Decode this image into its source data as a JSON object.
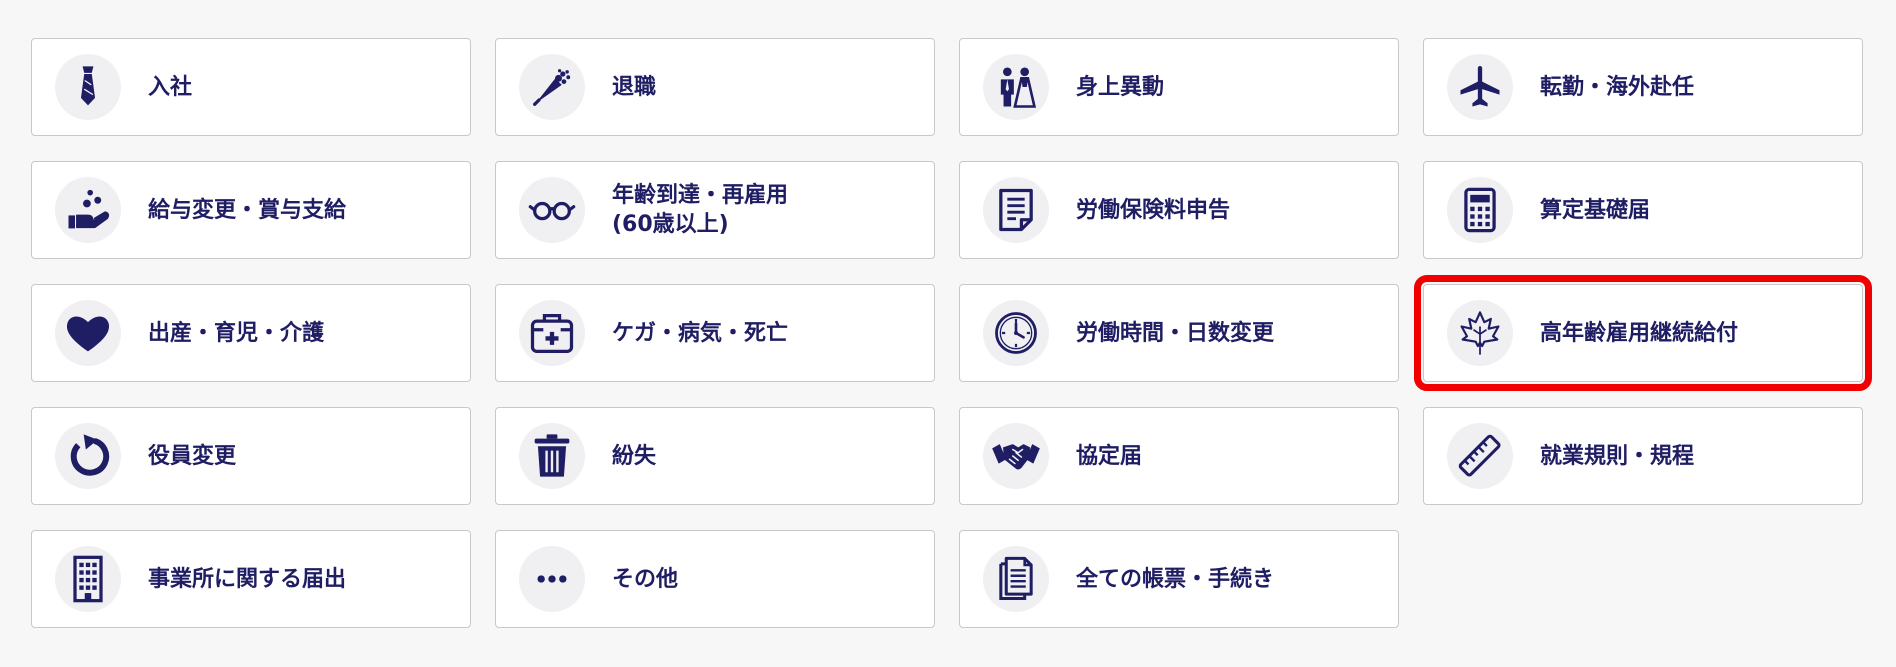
{
  "colors": {
    "accent": "#1f1d63",
    "highlight": "#f00000",
    "background": "#f7f7f7"
  },
  "cards": [
    {
      "label": "入社",
      "icon": "necktie-icon"
    },
    {
      "label": "退職",
      "icon": "bouquet-icon"
    },
    {
      "label": "身上異動",
      "icon": "wedding-couple-icon"
    },
    {
      "label": "転勤・海外赴任",
      "icon": "airplane-icon"
    },
    {
      "label": "給与変更・賞与支給",
      "icon": "hand-coins-icon"
    },
    {
      "label": "年齢到達・再雇用\n(60歳以上)",
      "icon": "glasses-icon"
    },
    {
      "label": "労働保険料申告",
      "icon": "document-icon"
    },
    {
      "label": "算定基礎届",
      "icon": "calculator-icon"
    },
    {
      "label": "出産・育児・介護",
      "icon": "heart-icon"
    },
    {
      "label": "ケガ・病気・死亡",
      "icon": "first-aid-kit-icon"
    },
    {
      "label": "労働時間・日数変更",
      "icon": "clock-icon"
    },
    {
      "label": "高年齢雇用継続給付",
      "icon": "maple-leaf-icon",
      "highlighted": true
    },
    {
      "label": "役員変更",
      "icon": "refresh-icon"
    },
    {
      "label": "紛失",
      "icon": "trash-icon"
    },
    {
      "label": "協定届",
      "icon": "handshake-icon"
    },
    {
      "label": "就業規則・規程",
      "icon": "ruler-icon"
    },
    {
      "label": "事業所に関する届出",
      "icon": "building-icon"
    },
    {
      "label": "その他",
      "icon": "more-dots-icon"
    },
    {
      "label": "全ての帳票・手続き",
      "icon": "documents-icon"
    }
  ]
}
